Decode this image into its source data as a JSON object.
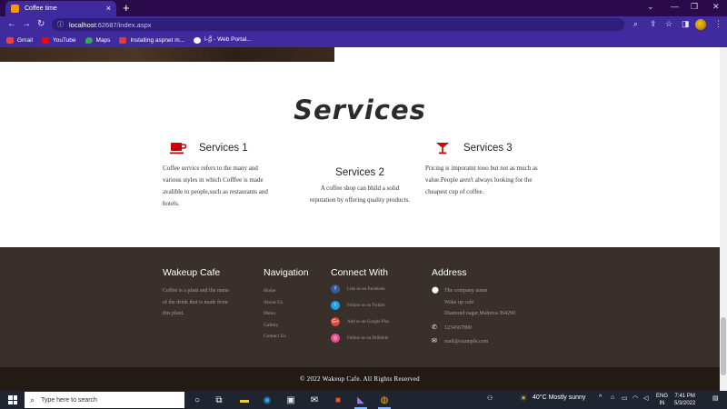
{
  "browser": {
    "tab_title": "Coffee time",
    "tab_close": "×",
    "new_tab": "+",
    "url_host": "localhost",
    "url_path": ":62687/index.aspx",
    "bookmarks": [
      {
        "label": "Gmail",
        "color": "#ea4335"
      },
      {
        "label": "YouTube",
        "color": "#ff0000"
      },
      {
        "label": "Maps",
        "color": "#34a853"
      },
      {
        "label": "Installing aspnet m...",
        "color": "#e53935"
      },
      {
        "label": "ὶ-ශ්‍රී - Web Portal...",
        "color": "#ffffff"
      }
    ]
  },
  "services": {
    "title": "Services",
    "items": [
      {
        "name": "Services 1",
        "icon": "coffee-cup-icon",
        "text_lines": [
          "Coffee service refers to the many and",
          "various styles in which Cofffee is made",
          "avalible to people,such as restaurants and",
          "hotels."
        ]
      },
      {
        "name": "Services 2",
        "icon": "",
        "text_lines": [
          "A coffee shop can bhild a solid",
          "reputation by offering quality products."
        ]
      },
      {
        "name": "Services 3",
        "icon": "cocktail-glass-icon",
        "text_lines": [
          "Pricing is imporatnt tooo but not as much as",
          "value.People aren't always looking for the",
          "cheapest cup of coffee."
        ]
      }
    ],
    "accent_color": "#cc0000"
  },
  "footer": {
    "about": {
      "title": "Wakeup Cafe",
      "text_lines": [
        "Coffee is a plant and the name",
        "of the drink that is made from",
        "this plant."
      ]
    },
    "navigation": {
      "title": "Navigation",
      "links": [
        "Home",
        "About Us",
        "Menu",
        "Gallery",
        "Contact Us"
      ]
    },
    "connect": {
      "title": "Connect With",
      "links": [
        {
          "label": "Like us on Facebook",
          "icon": "facebook-icon",
          "glyph": "f",
          "color": "#3b5998"
        },
        {
          "label": "Follow us on Twitter",
          "icon": "twitter-icon",
          "glyph": "t",
          "color": "#1da1f2"
        },
        {
          "label": "Add us on Google Plus",
          "icon": "google-plus-icon",
          "glyph": "G+",
          "color": "#dd4b39"
        },
        {
          "label": "Follow us on Dribbble",
          "icon": "dribbble-icon",
          "glyph": "◎",
          "color": "#ea4c89"
        }
      ]
    },
    "address": {
      "title": "Address",
      "lines": [
        "The company name",
        "Wake up cafe",
        "Diamond nagar,Mahuva-364290"
      ],
      "phone": "1234567890",
      "email": "mail@example.com"
    },
    "copyright": "© 2022 Wakeup Cafe. All Rights Reserved"
  },
  "taskbar": {
    "search_placeholder": "Type here to search",
    "weather": "40°C  Mostly sunny",
    "lang_top": "ENG",
    "lang_bottom": "IN",
    "time": "7:41 PM",
    "date": "5/3/2022"
  }
}
